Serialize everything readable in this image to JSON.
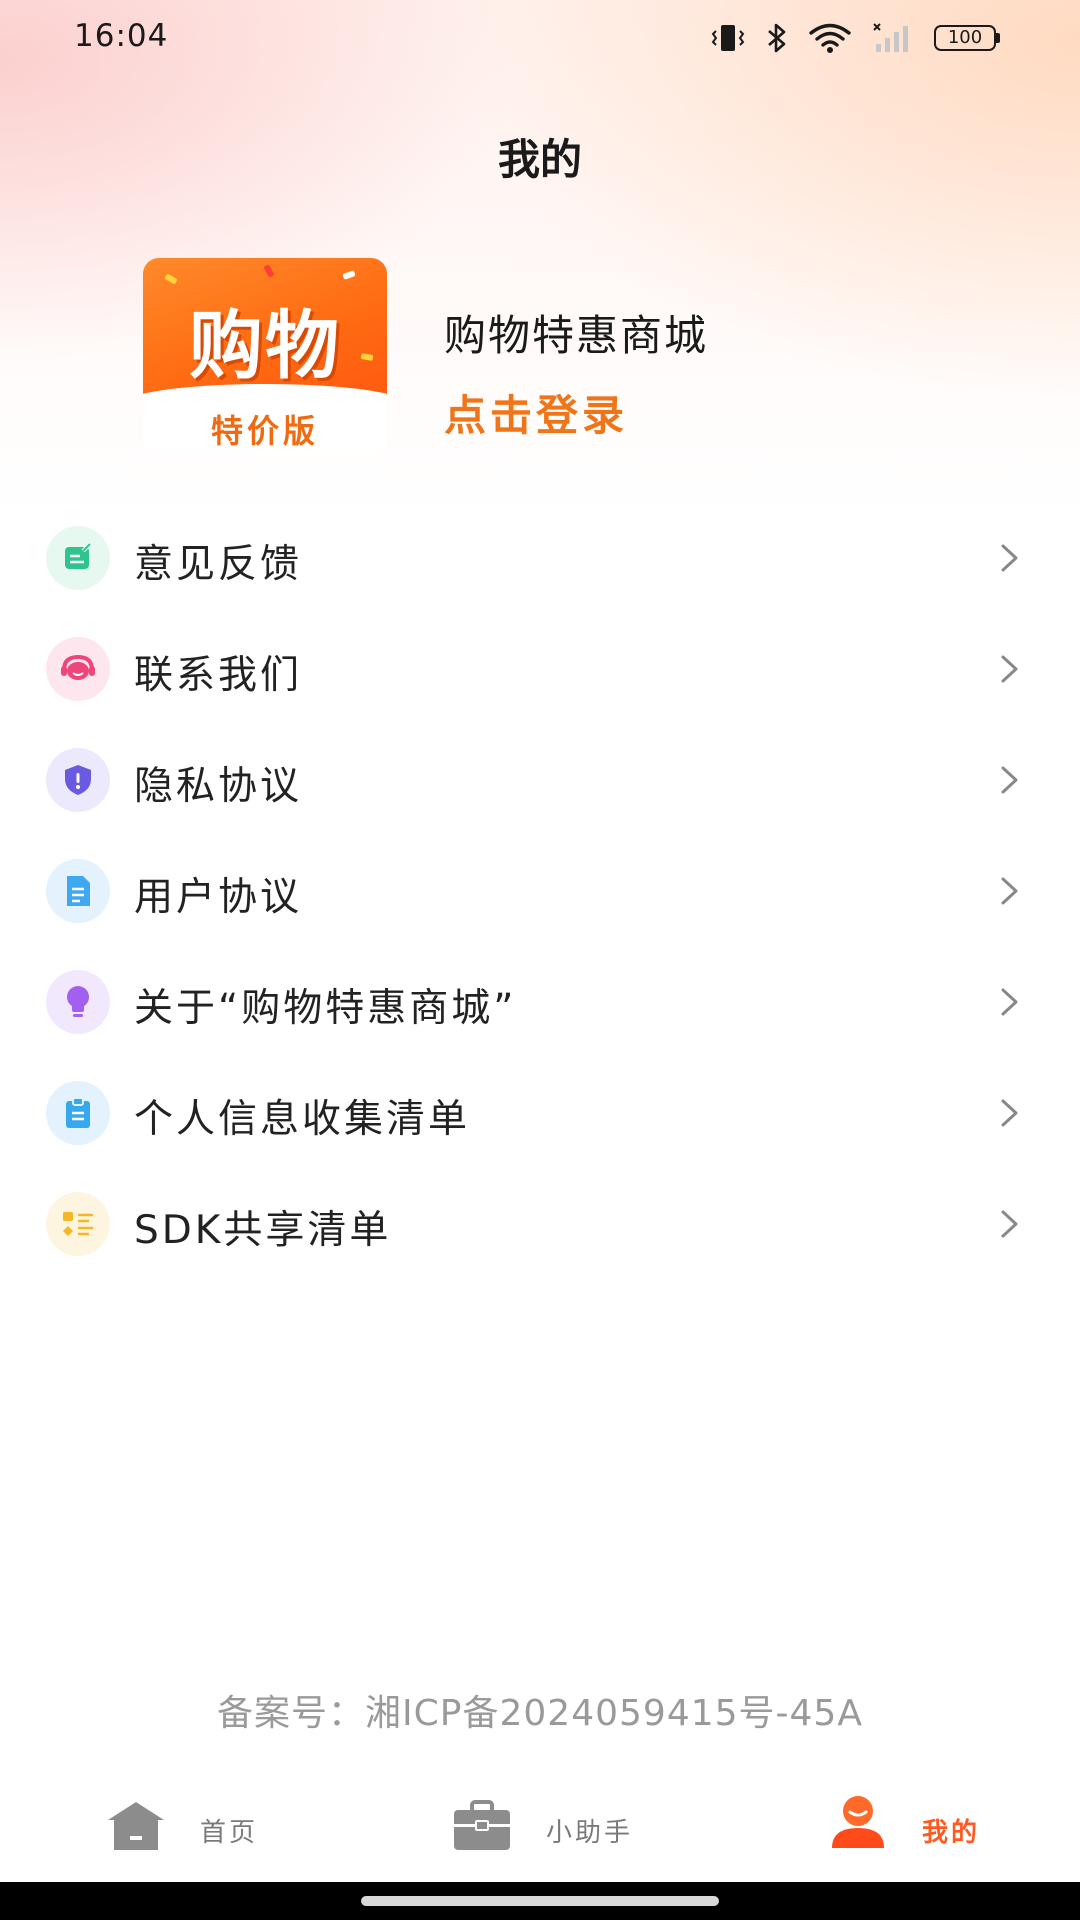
{
  "status_bar": {
    "time": "16:04",
    "battery": "100",
    "icons": [
      "vibrate-icon",
      "bluetooth-icon",
      "wifi-icon",
      "signal-no-sim-icon",
      "battery-icon"
    ]
  },
  "page": {
    "title": "我的"
  },
  "profile": {
    "logo_main": "购物",
    "logo_sub": "特价版",
    "app_name": "购物特惠商城",
    "login_label": "点击登录"
  },
  "menu": {
    "items": [
      {
        "label": "意见反馈",
        "icon": "feedback-icon",
        "color": "#2fc48f",
        "bg": "#e6f8f0"
      },
      {
        "label": "联系我们",
        "icon": "headset-icon",
        "color": "#f0457a",
        "bg": "#fde6ee"
      },
      {
        "label": "隐私协议",
        "icon": "shield-icon",
        "color": "#6a5ae0",
        "bg": "#ebe9fb"
      },
      {
        "label": "用户协议",
        "icon": "document-icon",
        "color": "#3ea9f0",
        "bg": "#e3f2fd"
      },
      {
        "label": "关于“购物特惠商城”",
        "icon": "lightbulb-icon",
        "color": "#a25ff0",
        "bg": "#f2e8fd"
      },
      {
        "label": "个人信息收集清单",
        "icon": "clipboard-icon",
        "color": "#36a8ee",
        "bg": "#e3f2fd"
      },
      {
        "label": "SDK共享清单",
        "icon": "list-icon",
        "color": "#f5b628",
        "bg": "#fdf5e0"
      }
    ]
  },
  "footer": {
    "icp": "备案号：湘ICP备2024059415号-45A"
  },
  "tabs": [
    {
      "label": "首页",
      "icon": "home-icon",
      "active": false
    },
    {
      "label": "小助手",
      "icon": "briefcase-icon",
      "active": false
    },
    {
      "label": "我的",
      "icon": "user-icon",
      "active": true
    }
  ],
  "colors": {
    "accent": "#f07418",
    "tab_active": "#ff5a1f",
    "text": "#222222",
    "muted": "#9a9a9a"
  }
}
